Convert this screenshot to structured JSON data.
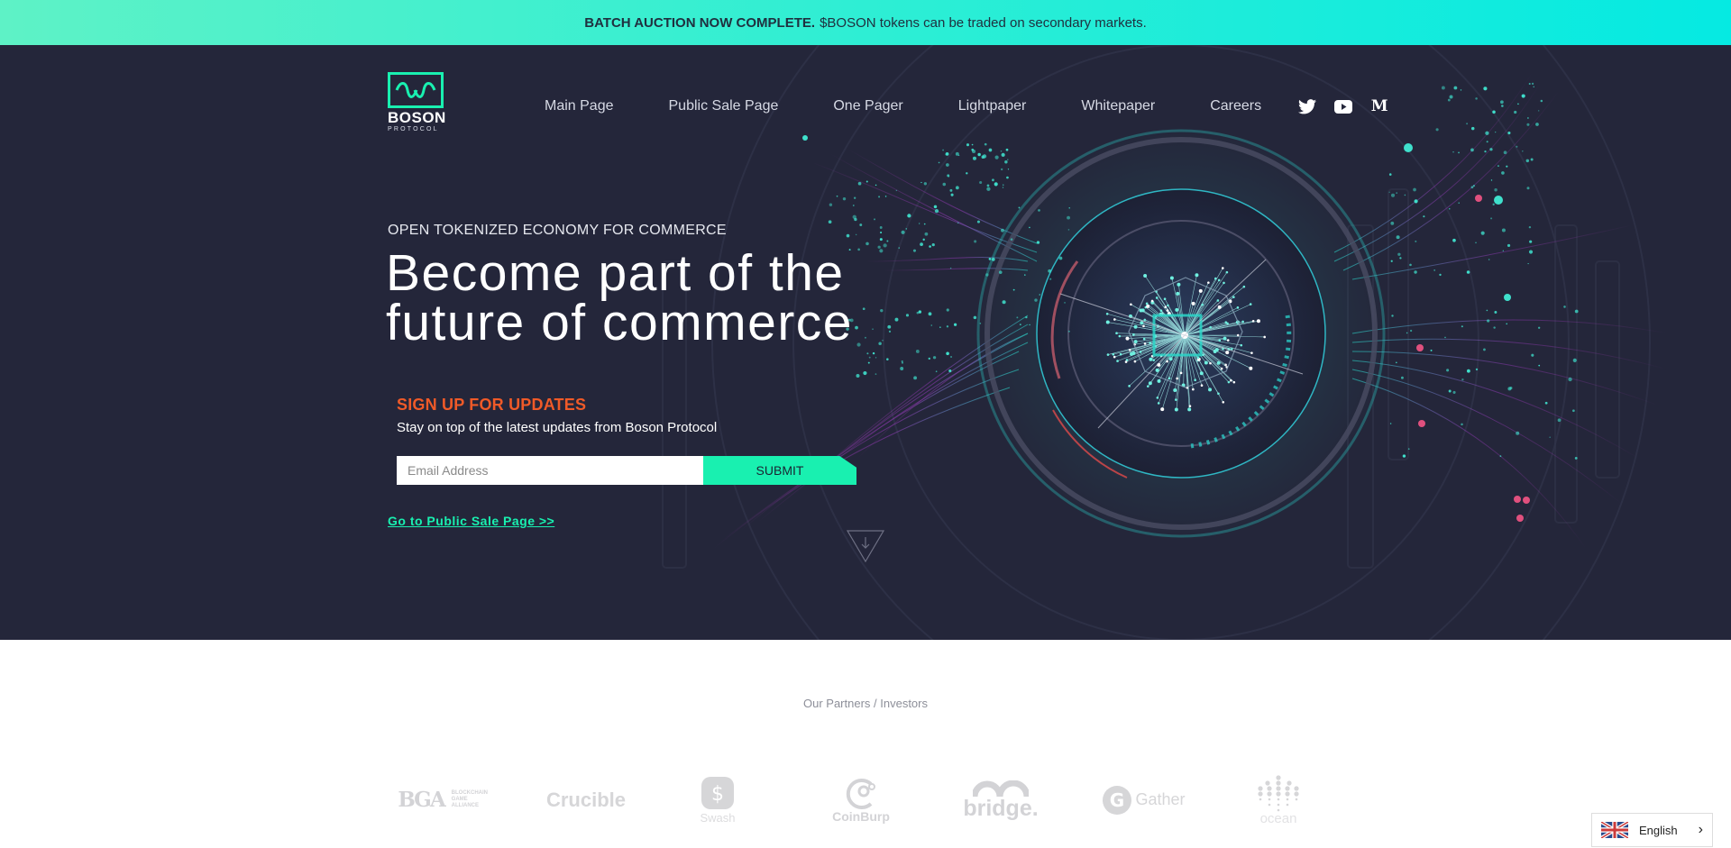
{
  "banner": {
    "bold": "BATCH AUCTION NOW COMPLETE.",
    "text": "$BOSON tokens can be traded on secondary markets."
  },
  "logo": {
    "word": "BOSON",
    "sub": "PROTOCOL"
  },
  "nav": {
    "items": [
      {
        "label": "Main Page"
      },
      {
        "label": "Public Sale Page"
      },
      {
        "label": "One Pager"
      },
      {
        "label": "Lightpaper"
      },
      {
        "label": "Whitepaper"
      },
      {
        "label": "Careers"
      }
    ],
    "social": [
      {
        "icon": "twitter-icon"
      },
      {
        "icon": "youtube-icon"
      },
      {
        "icon": "medium-icon",
        "glyph": "M"
      }
    ]
  },
  "hero": {
    "eyebrow": "OPEN TOKENIZED ECONOMY FOR COMMERCE",
    "headline_line1": "Become part of the",
    "headline_line2": "future of commerce"
  },
  "signup": {
    "title": "SIGN UP FOR UPDATES",
    "description": "Stay on top of the latest updates from Boson Protocol",
    "email_placeholder": "Email Address",
    "email_value": "",
    "submit_label": "SUBMIT"
  },
  "sale_link": "Go to Public Sale Page >>",
  "partners": {
    "title": "Our Partners / Investors",
    "items": [
      {
        "name": "BGA",
        "sub": "BLOCKCHAIN GAME ALLIANCE"
      },
      {
        "name": "Crucible"
      },
      {
        "name": "Swash"
      },
      {
        "name": "CoinBurp"
      },
      {
        "name": "bridge."
      },
      {
        "name": "Gather"
      },
      {
        "name": "ocean"
      }
    ]
  },
  "language": {
    "selected": "English"
  },
  "colors": {
    "banner_start": "#5ef2c6",
    "banner_end": "#05eae2",
    "hero_bg": "#24263a",
    "accent_green": "#19f0b0",
    "accent_orange": "#f05a28",
    "partner_gray": "#d3d3d6"
  }
}
